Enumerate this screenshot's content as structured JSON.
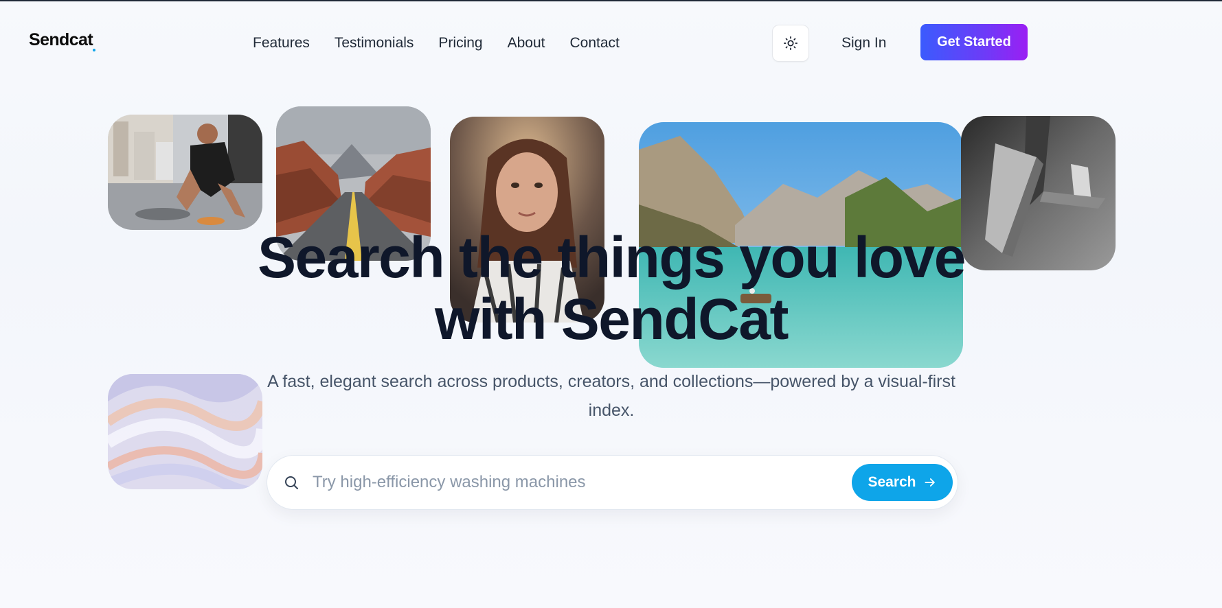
{
  "brand": {
    "name": "Sendcat",
    "accent": "#0ea5e9"
  },
  "nav": {
    "items": [
      {
        "label": "Features"
      },
      {
        "label": "Testimonials"
      },
      {
        "label": "Pricing"
      },
      {
        "label": "About"
      },
      {
        "label": "Contact"
      }
    ],
    "theme_toggle_icon": "sun-icon",
    "signin_label": "Sign In",
    "cta_label": "Get Started",
    "cta_gradient": [
      "#3b5bfd",
      "#9b1ff3"
    ]
  },
  "hero": {
    "title_line1": "Search the things you love",
    "title_line2": "with SendCat",
    "subtitle_line1": "A fast, elegant search across products, creators, and collections—powered by a visual-first",
    "subtitle_line2": "index."
  },
  "gallery": {
    "images": [
      {
        "name": "runner-tying-shoe-photo"
      },
      {
        "name": "desert-road-photo"
      },
      {
        "name": "woman-portrait-photo"
      },
      {
        "name": "mountain-lake-photo"
      },
      {
        "name": "abstract-3d-shapes-photo"
      },
      {
        "name": "abstract-waves-photo"
      }
    ]
  },
  "search": {
    "placeholder": "Try high-efficiency washing machines",
    "value": "",
    "button_label": "Search",
    "icon": "search-icon",
    "button_icon": "arrow-right-icon",
    "button_color": "#0ea5e9"
  }
}
